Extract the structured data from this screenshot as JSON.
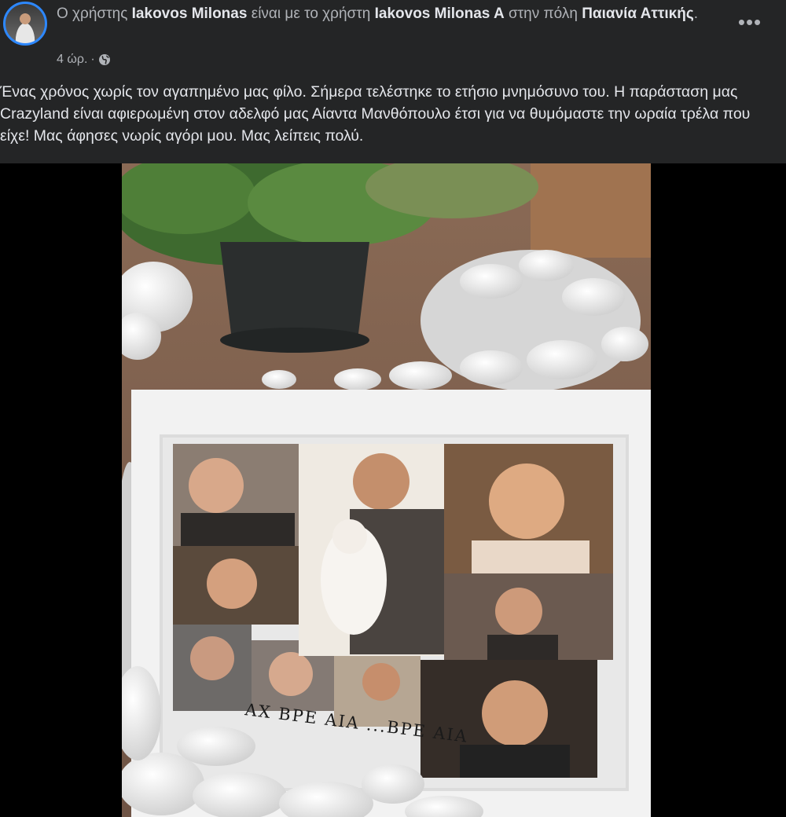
{
  "post": {
    "header": {
      "prefix": "Ο χρήστης",
      "author": "Iakovos Milonas",
      "with_text": "είναι με το χρήστη",
      "tagged_user": "Iakovos Milonas A",
      "place_text": "στην πόλη",
      "place": "Παιανία Αττικής",
      "place_suffix": "."
    },
    "meta": {
      "time": "4 ώρ.",
      "separator": "·",
      "privacy_icon": "globe-icon"
    },
    "more_icon": "more-options-icon",
    "more_label": "•••",
    "text": "Ένας χρόνος χωρίς τον αγαπημένο μας φίλο. Σήμερα τελέστηκε το ετήσιο μνημόσυνο του. Η παράσταση μας Crazyland είναι αφιερωμένη στον αδελφό μας Αίαντα Μανθόπουλο έτσι για να θυμόμαστε την ωραία τρέλα που είχε!  Μας άφησες νωρίς αγόρι μου. Μας λείπεις πολύ.",
    "photo": {
      "caption": "ΑΧ ΒΡΕ ΑΙΑ ...ΒΡΕ ΑΙΑ"
    }
  },
  "colors": {
    "header_bg": "#242526",
    "primary_text": "#e4e6eb",
    "secondary_text": "#b0b3b8",
    "avatar_ring": "#2d88ff"
  }
}
